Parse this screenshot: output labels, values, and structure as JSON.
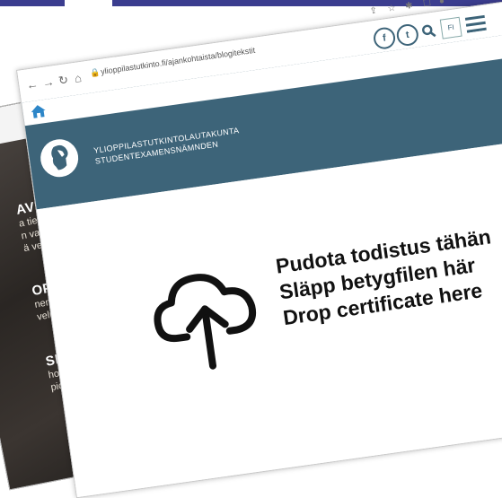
{
  "browser": {
    "url": "ylioppilastutkinto.fi/ajankohtaista/blogitekstit"
  },
  "site": {
    "org_line1": "YLIOPPILASTUTKINTOLAUTAKUNTA",
    "org_line2": "STUDENTEXAMENSNÄMNDEN",
    "lang": "FI"
  },
  "drop": {
    "line1": "Pudota todistus tähän",
    "line2": "Släpp betygfilen här",
    "line3": "Drop certificate here"
  },
  "background": {
    "h1": "AVIRU",
    "t1a": "a tiedot",
    "t1b": "n varaut",
    "t1c": "ä verkkos",
    "h2": "OPALVE",
    "t2a": "nen kokem",
    "t2b": "velu",
    "h3": "SET JA",
    "t3a": "hosten, k",
    "t3b": "pioiden"
  },
  "colors": {
    "brand": "#3d6479",
    "topbar": "#3b3d8f"
  }
}
